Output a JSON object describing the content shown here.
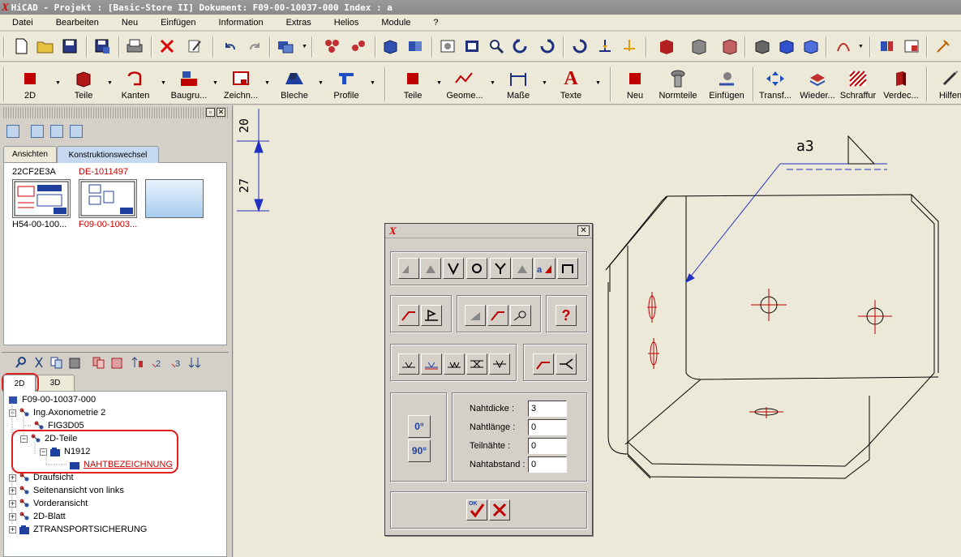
{
  "window": {
    "title": "HiCAD - Projekt : [Basic-Store II]  Dokument: F09-00-10037-000  Index : a"
  },
  "menu": [
    {
      "label": "Datei"
    },
    {
      "label": "Bearbeiten"
    },
    {
      "label": "Neu"
    },
    {
      "label": "Einfügen"
    },
    {
      "label": "Information"
    },
    {
      "label": "Extras"
    },
    {
      "label": "Helios"
    },
    {
      "label": "Module"
    },
    {
      "label": "?"
    }
  ],
  "toolbar2": {
    "items": [
      "2D",
      "Teile",
      "Kanten",
      "Baugru...",
      "Zeichn...",
      "Bleche",
      "Profile",
      "Teile",
      "Geome...",
      "Maße",
      "Texte",
      "Neu",
      "Normteile",
      "Einfügen",
      "Transf...",
      "Wieder...",
      "Schraffur",
      "Verdec...",
      "Hilfen"
    ]
  },
  "left_panel": {
    "tabs": [
      "Ansichten",
      "Konstruktionswechsel"
    ],
    "thumbs": [
      {
        "top_label": "22CF2E3A",
        "bottom_label": "H54-00-100...",
        "top_color": "#000000",
        "bottom_color": "#000000"
      },
      {
        "top_label": "DE-1011497",
        "bottom_label": "F09-00-1003...",
        "top_color": "#cc0000",
        "bottom_color": "#cc0000"
      }
    ],
    "tree_tabs": [
      "2D",
      "3D"
    ],
    "tree": [
      {
        "label": "F09-00-10037-000"
      },
      {
        "label": "Ing.Axonometrie 2"
      },
      {
        "label": "FIG3D05"
      },
      {
        "label": "2D-Teile"
      },
      {
        "label": "N1912"
      },
      {
        "label": "NAHTBEZEICHNUNG"
      },
      {
        "label": "Draufsicht"
      },
      {
        "label": "Seitenansicht von links"
      },
      {
        "label": "Vorderansicht"
      },
      {
        "label": "2D-Blatt"
      },
      {
        "label": "ZTRANSPORTSICHERUNG"
      }
    ]
  },
  "canvas": {
    "dim_labels": [
      "20",
      "27"
    ],
    "weld_label": "a3"
  },
  "dialog": {
    "angle_buttons": [
      "0°",
      "90°"
    ],
    "fields": [
      {
        "label": "Nahtdicke  :",
        "value": "3"
      },
      {
        "label": "Nahtlänge  :",
        "value": "0"
      },
      {
        "label": "Teilnähte  :",
        "value": "0"
      },
      {
        "label": "Nahtabstand :",
        "value": "0"
      }
    ],
    "help": "?",
    "ok": "OK"
  }
}
